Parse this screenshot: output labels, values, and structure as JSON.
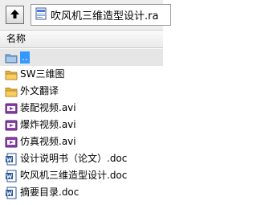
{
  "toolbar": {
    "up_button_icon": "up-arrow-icon",
    "path_text": "吹风机三维造型设计.ra"
  },
  "list_header": {
    "name_column": "名称"
  },
  "files": [
    {
      "name": "..",
      "icon": "parent-folder-icon",
      "selected": true
    },
    {
      "name": "SW三维图",
      "icon": "folder-icon"
    },
    {
      "name": "外文翻译",
      "icon": "folder-icon"
    },
    {
      "name": "装配视频.avi",
      "icon": "video-file-icon"
    },
    {
      "name": "爆炸视频.avi",
      "icon": "video-file-icon"
    },
    {
      "name": "仿真视频.avi",
      "icon": "video-file-icon"
    },
    {
      "name": "设计说明书（论文）.doc",
      "icon": "word-doc-icon"
    },
    {
      "name": "吹风机三维造型设计.doc",
      "icon": "word-doc-icon"
    },
    {
      "name": "摘要目录.doc",
      "icon": "word-doc-icon"
    }
  ],
  "colors": {
    "selection": "#3399ff",
    "folder": "#f2c04a",
    "video": "#8b3fa8",
    "word": "#2a5699"
  }
}
